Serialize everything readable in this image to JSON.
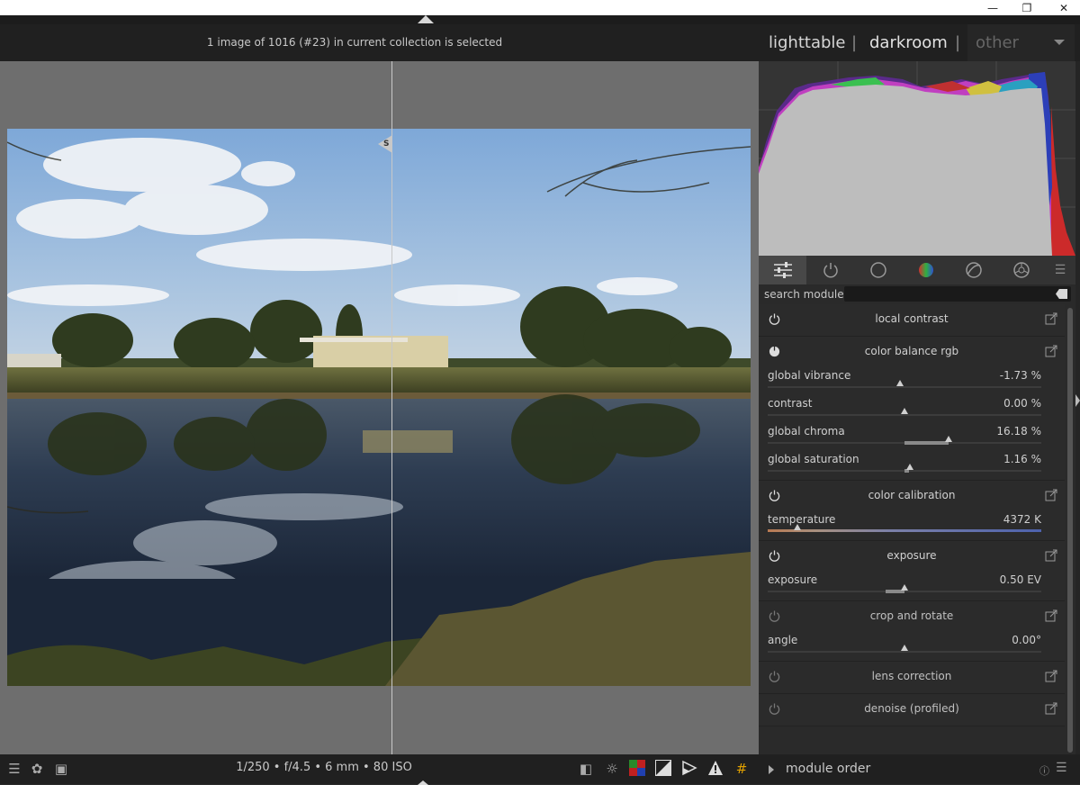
{
  "window": {
    "minimize_icon": "minimize-icon",
    "restore_icon": "restore-icon",
    "close_icon": "close-icon"
  },
  "header": {
    "selection_info": "1 image of 1016 (#23) in current collection is selected"
  },
  "views": {
    "lighttable": "lighttable",
    "sep1": "|",
    "darkroom": "darkroom",
    "sep2": "|",
    "other": "other"
  },
  "split_tag": "S",
  "exif": "1/250 • f/4.5 • 6 mm • 80 ISO",
  "colors": {
    "accent": "#c8c8c8",
    "panel": "#2b2b2b",
    "header": "#202020",
    "background": "#6e6e6e"
  },
  "module_groups": [
    {
      "name": "sliders-icon"
    },
    {
      "name": "power-icon"
    },
    {
      "name": "circle-icon"
    },
    {
      "name": "color-wheel-icon"
    },
    {
      "name": "correct-icon"
    },
    {
      "name": "effect-icon"
    },
    {
      "name": "menu-icon"
    }
  ],
  "search": {
    "label": "search module",
    "value": ""
  },
  "modules": [
    {
      "name": "local contrast",
      "enabled": true,
      "sliders": []
    },
    {
      "name": "color balance rgb",
      "enabled": true,
      "sliders": [
        {
          "label": "global vibrance",
          "value": "-1.73 %"
        },
        {
          "label": "contrast",
          "value": "0.00 %"
        },
        {
          "label": "global chroma",
          "value": "16.18 %"
        },
        {
          "label": "global saturation",
          "value": "1.16 %"
        }
      ]
    },
    {
      "name": "color calibration",
      "enabled": true,
      "sliders": [
        {
          "label": "temperature",
          "value": "4372 K"
        }
      ]
    },
    {
      "name": "exposure",
      "enabled": true,
      "sliders": [
        {
          "label": "exposure",
          "value": "0.50 EV"
        }
      ]
    },
    {
      "name": "crop and rotate",
      "enabled": false,
      "sliders": [
        {
          "label": "angle",
          "value": "0.00°"
        }
      ]
    },
    {
      "name": "lens correction",
      "enabled": false,
      "sliders": []
    },
    {
      "name": "denoise (profiled)",
      "enabled": false,
      "sliders": []
    }
  ],
  "slider_levels": {
    "global_vibrance": -0.017,
    "contrast": 0.0,
    "global_chroma": 0.16,
    "global_saturation": 0.012,
    "temperature_fraction": 0.1,
    "exposure_ev": 0.5,
    "angle": 0.0
  },
  "module_order": {
    "label": "module order"
  }
}
